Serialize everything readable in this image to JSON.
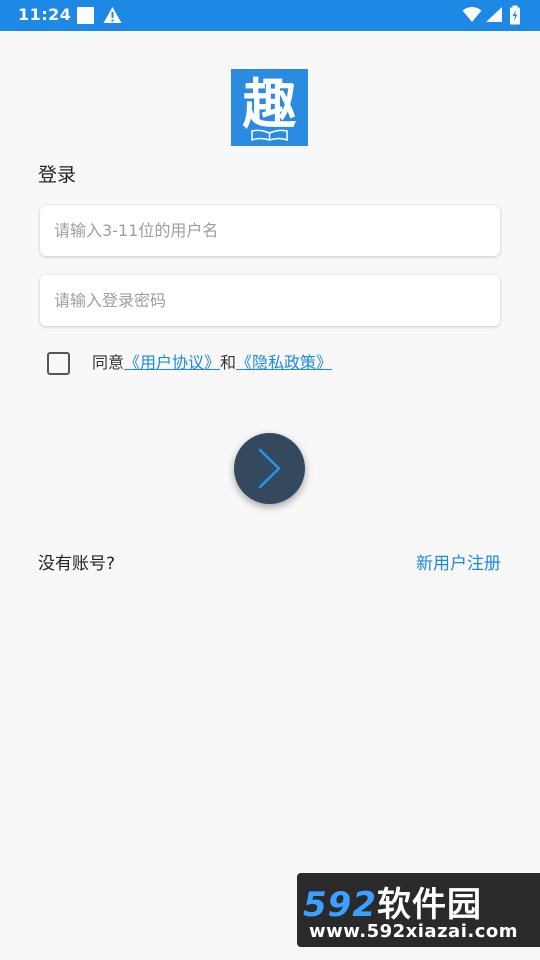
{
  "status_bar": {
    "time": "11:24",
    "icons": [
      "square-notification-icon",
      "warning-icon",
      "wifi-icon",
      "signal-icon",
      "battery-icon"
    ],
    "background": "#1e88e5"
  },
  "logo": {
    "glyph": "趣",
    "background": "#2a8be0"
  },
  "login": {
    "title": "登录",
    "username_placeholder": "请输入3-11位的用户名",
    "password_placeholder": "请输入登录密码",
    "agree_prefix": "同意",
    "user_agreement": "《用户协议》",
    "and": "和",
    "privacy_policy": "《隐私政策》",
    "submit_icon": "chevron-right-icon",
    "submit_bg": "#34495e"
  },
  "footer": {
    "no_account": "没有账号?",
    "register": "新用户注册",
    "link_color": "#1e88e5"
  },
  "watermark": {
    "brand_num": "592",
    "brand_text": "软件园",
    "url": "www.592xiazai.com"
  }
}
